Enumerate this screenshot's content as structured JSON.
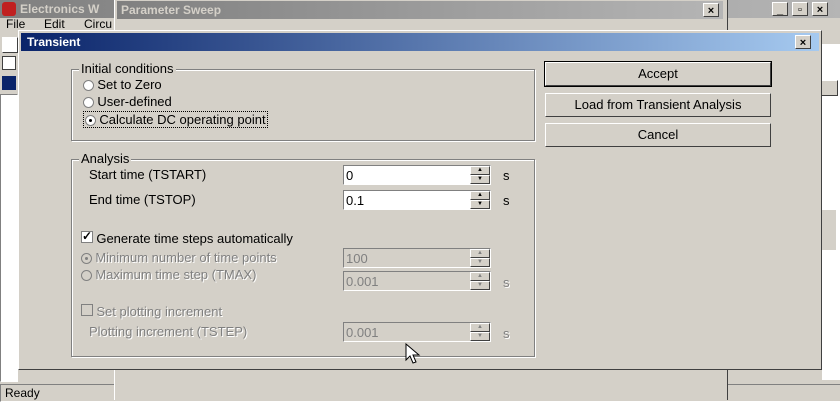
{
  "app": {
    "title": "Electronics W",
    "menu": {
      "file": "File",
      "edit": "Edit",
      "circuit": "Circu"
    },
    "status": "Ready"
  },
  "param_sweep": {
    "title": "Parameter Sweep"
  },
  "dialog": {
    "title": "Transient",
    "initial_conditions": {
      "legend": "Initial conditions",
      "options": [
        {
          "label": "Set to Zero",
          "checked": false
        },
        {
          "label": "User-defined",
          "checked": false
        },
        {
          "label": "Calculate DC operating point",
          "checked": true
        }
      ]
    },
    "analysis": {
      "legend": "Analysis",
      "start_time": {
        "label": "Start time (TSTART)",
        "value": "0",
        "unit": "s"
      },
      "end_time": {
        "label": "End time (TSTOP)",
        "value": "0.1",
        "unit": "s"
      },
      "auto_steps": {
        "label": "Generate time steps automatically",
        "checked": true
      },
      "min_points": {
        "label": "Minimum number of time points",
        "value": "100"
      },
      "max_step": {
        "label": "Maximum time step (TMAX)",
        "value": "0.001",
        "unit": "s"
      },
      "set_plot_increment": {
        "label": "Set plotting increment",
        "checked": false
      },
      "plot_increment": {
        "label": "Plotting increment (TSTEP)",
        "value": "0.001",
        "unit": "s"
      }
    },
    "buttons": {
      "accept": "Accept",
      "load": "Load from Transient Analysis",
      "cancel": "Cancel"
    }
  },
  "colors": {
    "face": "#d4d0c8",
    "active_title": "#0a246a",
    "inactive_title": "#808080"
  },
  "icons": [
    "app-icon",
    "close-icon",
    "minimize-icon",
    "restore-icon",
    "spin-up-icon",
    "spin-down-icon",
    "mouse-pointer-icon"
  ]
}
